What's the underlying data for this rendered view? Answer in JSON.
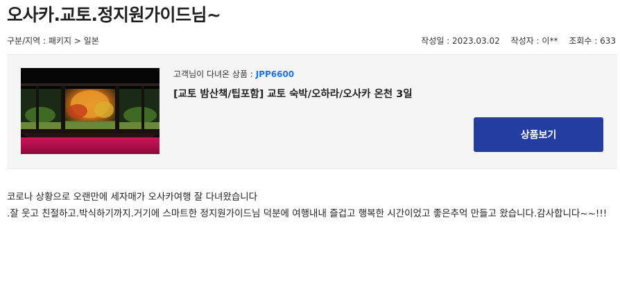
{
  "review_title": "오사카.교토.정지원가이드님~",
  "meta": {
    "category_label": "구분/지역 :",
    "category_value": "패키지 > 일본",
    "date_label": "작성일 :",
    "date_value": "2023.03.02",
    "author_label": "작성자 :",
    "author_value": "이**",
    "views_label": "조회수 :",
    "views_value": "633"
  },
  "product": {
    "visited_label": "고객님이 다녀온 상품 :",
    "code": "JPP6600",
    "name": "[교토 밤산책/팁포함] 교토 숙박/오하라/오사카 온천 3일",
    "view_button_label": "상품보기",
    "thumbnail_icon": "japanese-garden-photo"
  },
  "review_body": {
    "line1": "코로나 상황으로 오랜만에 세자매가 오사카여행 잘 다녀왔습니다",
    "line2": ".잘 웃고 친절하고.박식하기까지.거기에 스마트한 정지원가이드님 덕분에 여행내내 즐겁고 행복한 시간이었고 좋은추억 만들고 왔습니다.감사합니다~~!!!"
  },
  "colors": {
    "accent_button": "#233ea0",
    "product_code": "#1a73e8",
    "box_background": "#f5f5f5"
  }
}
